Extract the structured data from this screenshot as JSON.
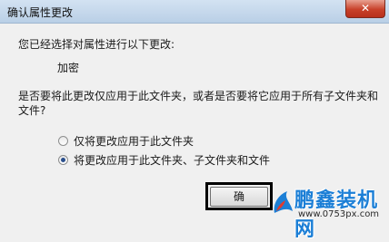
{
  "dialog": {
    "title": "确认属性更改",
    "close_label": "✕",
    "prompt": "您已经选择对属性进行以下更改:",
    "attribute": "加密",
    "question": "是否要将此更改仅应用于此文件夹，或者是否要将它应用于所有子文件夹和文件?",
    "options": [
      {
        "label": "仅将更改应用于此文件夹",
        "checked": false
      },
      {
        "label": "将更改应用于此文件夹、子文件夹和文件",
        "checked": true
      }
    ],
    "ok_label": "确"
  },
  "watermark": {
    "title": "鹏鑫装机网",
    "url": "www.0753px.com"
  }
}
